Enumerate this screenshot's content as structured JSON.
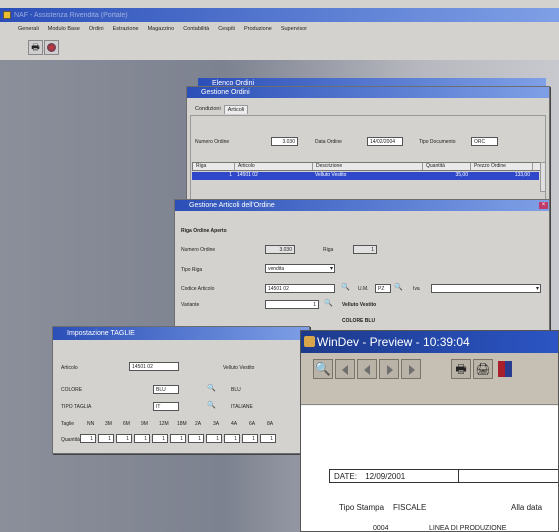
{
  "main_window": {
    "title": "NAF - Assistenza Rivendita (Portale)",
    "menu": [
      "Generali",
      "Modulo Base",
      "Ordini",
      "Estrazione",
      "Magazzino",
      "Contabilità",
      "Cespiti",
      "Produzione",
      "Supervisor"
    ]
  },
  "ordine_window": {
    "title_back": "Elenco Ordini",
    "title": "Gestione Ordini",
    "tabs": [
      "Condizioni",
      "Articoli"
    ],
    "numero_label": "Numero Ordine",
    "numero_value": "3.030",
    "data_label": "Data Ordine",
    "data_value": "14/02/2004",
    "tipo_label": "Tipo Documento",
    "tipo_value": "ORC",
    "columns": [
      "Riga",
      "Articolo",
      "Descrizione",
      "Quantità",
      "Prezzo Ordine"
    ],
    "row": [
      "1",
      "14501 02",
      "Velluto Vestito",
      "35,00",
      "133,00"
    ]
  },
  "articoli_window": {
    "title": "Gestione Articoli dell'Ordine",
    "section": "Riga Ordine Aperto",
    "numero_label": "Numero Ordine",
    "numero_value": "3.030",
    "riga_label": "Riga",
    "riga_value": "1",
    "tipo_label": "Tipo Riga",
    "tipo_value": "vendita",
    "codice_label": "Codice Articolo",
    "codice_value": "14501 02",
    "um_label": "U.M.",
    "um_value": "PZ",
    "iva_label": "Iva",
    "variante_label": "Variante",
    "variante_value": "1",
    "desc1": "Velluto Vestito",
    "desc2": "COLORE BLU"
  },
  "taglie_window": {
    "title": "Impostazione TAGLIE",
    "articolo_label": "Articolo",
    "articolo_value": "14501 02",
    "articolo_desc": "Velluto Vestito",
    "colore_label": "COLORE",
    "colore_value": "BLU",
    "colore_desc": "BLU",
    "tipo_label": "TIPO TAGLIA",
    "tipo_value": "IT",
    "tipo_desc": "ITALIANE",
    "taglie_label": "Taglie",
    "taglie": [
      "NN",
      "3M",
      "6M",
      "9M",
      "12M",
      "18M",
      "2A",
      "3A",
      "4A",
      "6A",
      "8A"
    ],
    "quantita_label": "Quantità",
    "quantita": [
      "1",
      "1",
      "1",
      "1",
      "1",
      "1",
      "1",
      "1",
      "1",
      "1",
      "1"
    ]
  },
  "preview_window": {
    "title": "WinDev - Preview - 10:39:04",
    "date_label": "DATE:",
    "date_value": "12/09/2001",
    "tipo_label": "Tipo Stampa",
    "tipo_value": "FISCALE",
    "alla_label": "Alla data",
    "code": "0004",
    "line": "LINEA DI PRODUZIONE"
  }
}
